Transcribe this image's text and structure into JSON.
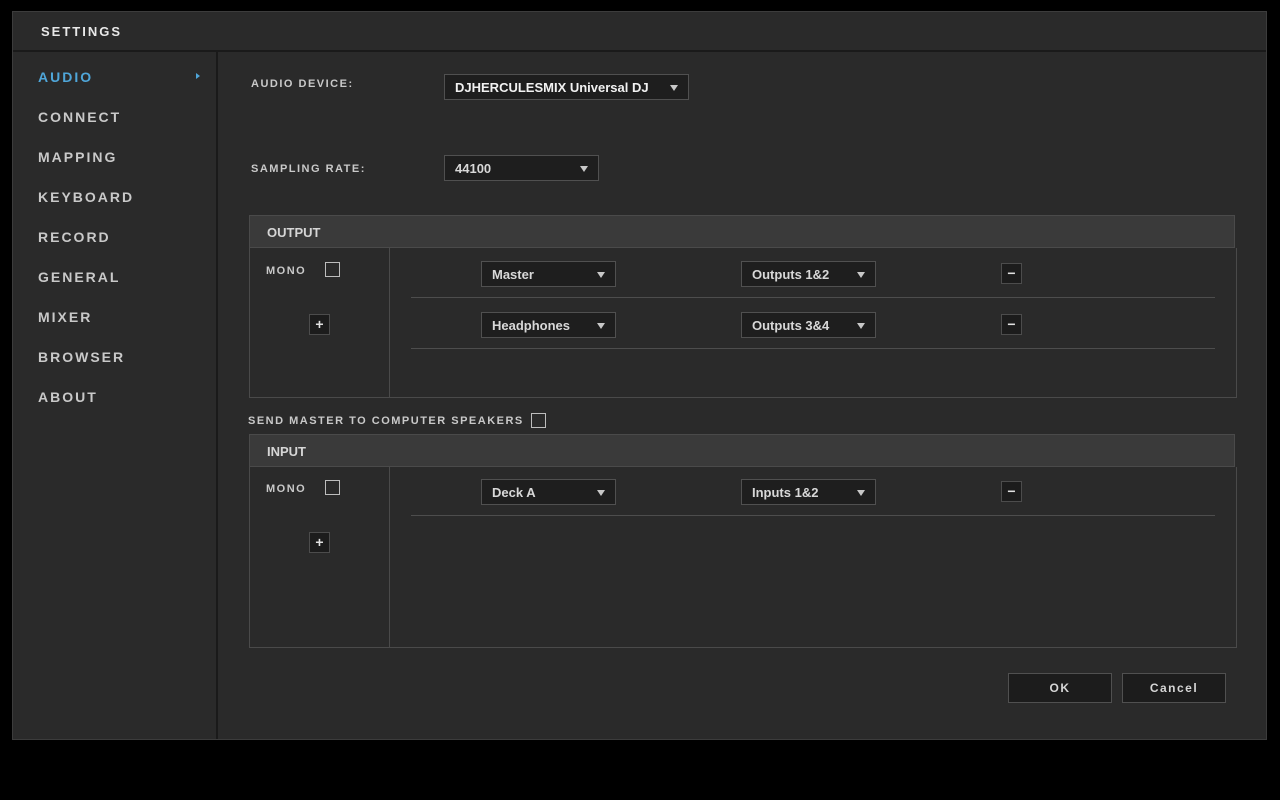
{
  "window": {
    "title": "SETTINGS"
  },
  "sidebar": {
    "items": [
      {
        "label": "AUDIO",
        "active": true
      },
      {
        "label": "CONNECT"
      },
      {
        "label": "MAPPING"
      },
      {
        "label": "KEYBOARD"
      },
      {
        "label": "RECORD"
      },
      {
        "label": "GENERAL"
      },
      {
        "label": "MIXER"
      },
      {
        "label": "BROWSER"
      },
      {
        "label": "ABOUT"
      }
    ]
  },
  "audio": {
    "device_label": "AUDIO DEVICE:",
    "device_value": "DJHERCULESMIX Universal DJ",
    "rate_label": "SAMPLING RATE:",
    "rate_value": "44100",
    "output": {
      "title": "OUTPUT",
      "mono_label": "MONO",
      "add_symbol": "+",
      "rows": [
        {
          "channel": "Master",
          "route": "Outputs 1&2",
          "remove_symbol": "−"
        },
        {
          "channel": "Headphones",
          "route": "Outputs 3&4",
          "remove_symbol": "−"
        }
      ]
    },
    "send_master_label": "SEND MASTER TO COMPUTER SPEAKERS",
    "input": {
      "title": "INPUT",
      "mono_label": "MONO",
      "add_symbol": "+",
      "rows": [
        {
          "channel": "Deck A",
          "route": "Inputs 1&2",
          "remove_symbol": "−"
        }
      ]
    }
  },
  "actions": {
    "ok_label": "OK",
    "cancel_label": "Cancel"
  }
}
